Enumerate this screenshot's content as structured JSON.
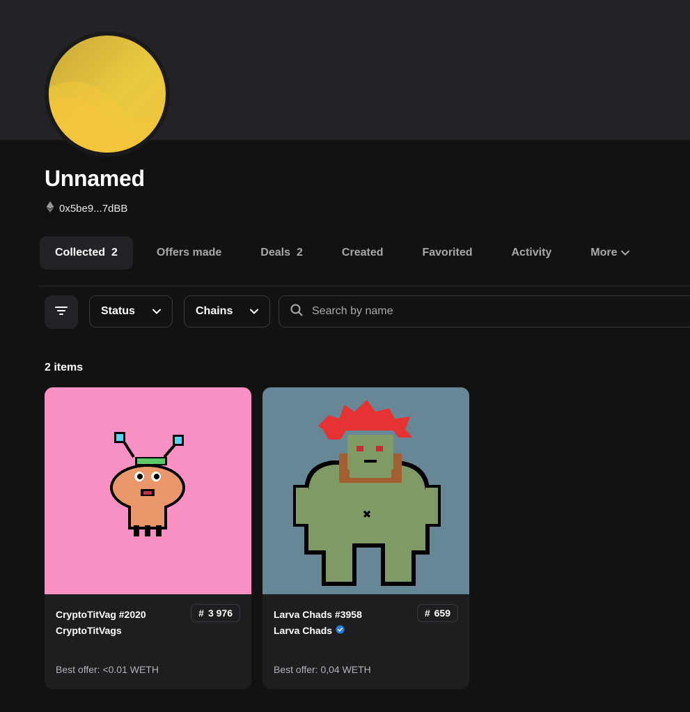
{
  "profile": {
    "name": "Unnamed",
    "address": "0x5be9...7dBB"
  },
  "tabs": [
    {
      "label": "Collected",
      "count": "2"
    },
    {
      "label": "Offers made",
      "count": ""
    },
    {
      "label": "Deals",
      "count": "2"
    },
    {
      "label": "Created",
      "count": ""
    },
    {
      "label": "Favorited",
      "count": ""
    },
    {
      "label": "Activity",
      "count": ""
    },
    {
      "label": "More",
      "count": ""
    }
  ],
  "filters": {
    "status_label": "Status",
    "chains_label": "Chains",
    "search_placeholder": "Search by name"
  },
  "items_count": "2 items",
  "cards": [
    {
      "title": "CryptoTitVag #2020",
      "collection": "CryptoTitVags",
      "rank_symbol": "#",
      "rank": "3 976",
      "best_offer": "Best offer: <0.01 WETH",
      "bg_color": "#f991c5",
      "verified": false
    },
    {
      "title": "Larva Chads #3958",
      "collection": "Larva Chads",
      "rank_symbol": "#",
      "rank": "659",
      "best_offer": "Best offer: 0,04 WETH",
      "bg_color": "#678797",
      "verified": true
    }
  ],
  "colors": {
    "background": "#121212",
    "banner": "#232327",
    "active_tab": "#232327",
    "verified_badge": "#2081e2"
  }
}
